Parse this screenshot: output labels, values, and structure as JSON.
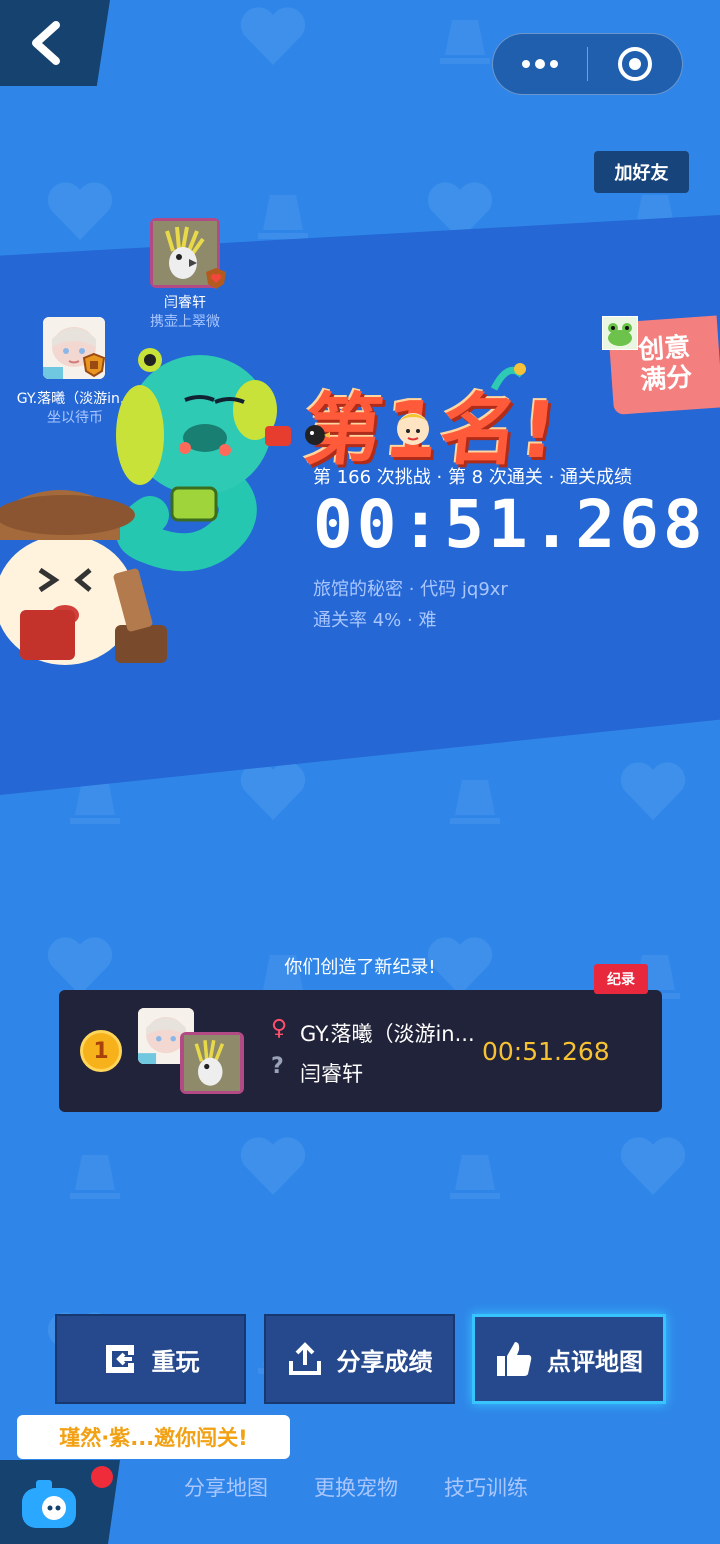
{
  "top": {
    "add_friend": "加好友"
  },
  "players": {
    "p1": {
      "name": "闫睿轩",
      "sub": "携壶上翠微"
    },
    "p2": {
      "name": "GY.落曦（淡游in...",
      "sub": "坐以待币"
    }
  },
  "result": {
    "rank_title": "第1名!",
    "stats": "第 166 次挑战 · 第 8 次通关 · 通关成绩",
    "time": "00:51.268",
    "map_info": "旅馆的秘密 · 代码 jq9xr",
    "pass_rate": "通关率 4% · 难",
    "creative_tag_line1": "创意",
    "creative_tag_line2": "满分"
  },
  "record": {
    "headline": "你们创造了新纪录!",
    "badge": "纪录",
    "rank": "1",
    "player1": "GY.落曦（淡游in...",
    "player2": "闫睿轩",
    "time": "00:51.268"
  },
  "buttons": {
    "replay": "重玩",
    "share_score": "分享成绩",
    "review_map": "点评地图"
  },
  "invite": "瑾然·紫...邀你闯关!",
  "bottom_links": {
    "share_map": "分享地图",
    "change_pet": "更换宠物",
    "skill_training": "技巧训练"
  },
  "colors": {
    "background": "#2f86e8",
    "band": "#2467d5",
    "accent_time": "#f6c231",
    "title_red": "#ff5b3a"
  }
}
